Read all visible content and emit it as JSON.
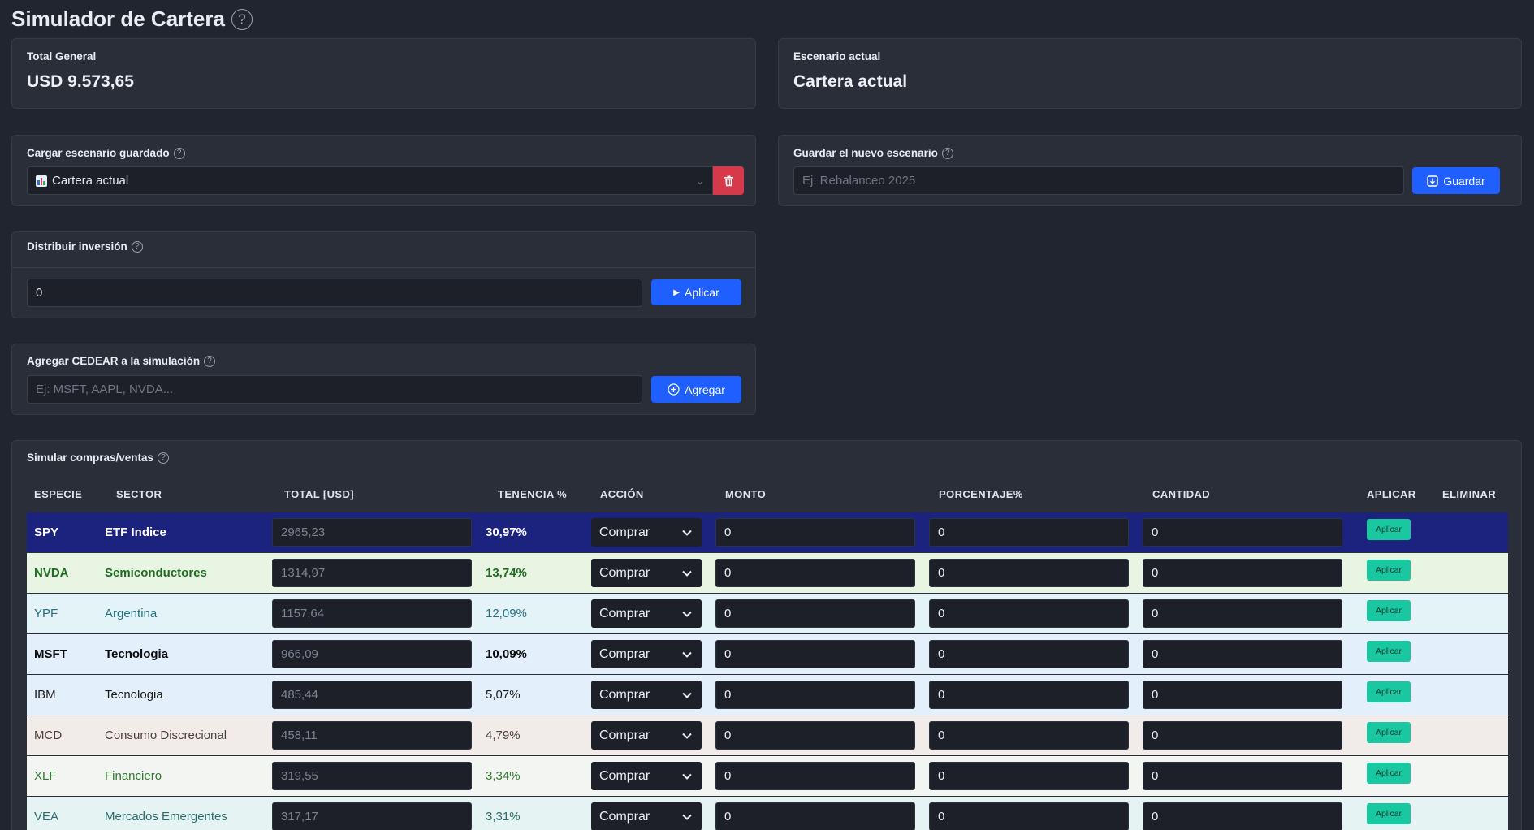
{
  "page": {
    "title": "Simulador de Cartera"
  },
  "total_card": {
    "label": "Total General",
    "value": "USD 9.573,65"
  },
  "scenario_card": {
    "label": "Escenario actual",
    "value": "Cartera actual"
  },
  "load_scenario": {
    "label": "Cargar escenario guardado",
    "selected": "Cartera actual",
    "icon": "bar-chart-emoji"
  },
  "save_scenario": {
    "label": "Guardar el nuevo escenario",
    "placeholder": "Ej: Rebalanceo 2025",
    "button": "Guardar"
  },
  "distribute": {
    "label": "Distribuir inversión",
    "value": "0",
    "button": "Aplicar"
  },
  "add_cedear": {
    "label": "Agregar CEDEAR a la simulación",
    "placeholder": "Ej: MSFT, AAPL, NVDA...",
    "button": "Agregar"
  },
  "simulate": {
    "label": "Simular compras/ventas",
    "columns": [
      "ESPECIE",
      "SECTOR",
      "TOTAL [USD]",
      "TENENCIA %",
      "ACCIÓN",
      "MONTO",
      "PORCENTAJE%",
      "CANTIDAD",
      "APLICAR",
      "ELIMINAR"
    ],
    "action_default": "Comprar",
    "apply_label": "Aplicar",
    "rows": [
      {
        "especie": "SPY",
        "sector": "ETF Indice",
        "total": "2965,23",
        "tenencia": "30,97%",
        "monto": "0",
        "porcentaje": "0",
        "cantidad": "0",
        "bg": "#1b237f",
        "fg": "#ffffff",
        "bold": true
      },
      {
        "especie": "NVDA",
        "sector": "Semiconductores",
        "total": "1314,97",
        "tenencia": "13,74%",
        "monto": "0",
        "porcentaje": "0",
        "cantidad": "0",
        "bg": "#e9f5e3",
        "fg": "#1f6b1f",
        "bold": true
      },
      {
        "especie": "YPF",
        "sector": "Argentina",
        "total": "1157,64",
        "tenencia": "12,09%",
        "monto": "0",
        "porcentaje": "0",
        "cantidad": "0",
        "bg": "#e3f3f8",
        "fg": "#24707e",
        "bold": false
      },
      {
        "especie": "MSFT",
        "sector": "Tecnologia",
        "total": "966,09",
        "tenencia": "10,09%",
        "monto": "0",
        "porcentaje": "0",
        "cantidad": "0",
        "bg": "#e3f0fb",
        "fg": "#0b0b0b",
        "bold": true
      },
      {
        "especie": "IBM",
        "sector": "Tecnologia",
        "total": "485,44",
        "tenencia": "5,07%",
        "monto": "0",
        "porcentaje": "0",
        "cantidad": "0",
        "bg": "#e3f0fb",
        "fg": "#1a1a1a",
        "bold": false
      },
      {
        "especie": "MCD",
        "sector": "Consumo Discrecional",
        "total": "458,11",
        "tenencia": "4,79%",
        "monto": "0",
        "porcentaje": "0",
        "cantidad": "0",
        "bg": "#f1ecea",
        "fg": "#4e3f3a",
        "bold": false
      },
      {
        "especie": "XLF",
        "sector": "Financiero",
        "total": "319,55",
        "tenencia": "3,34%",
        "monto": "0",
        "porcentaje": "0",
        "cantidad": "0",
        "bg": "#f3f5f3",
        "fg": "#2f7a2f",
        "bold": false
      },
      {
        "especie": "VEA",
        "sector": "Mercados Emergentes",
        "total": "317,17",
        "tenencia": "3,31%",
        "monto": "0",
        "porcentaje": "0",
        "cantidad": "0",
        "bg": "#e5f3f3",
        "fg": "#2b6b6b",
        "bold": false
      }
    ]
  }
}
